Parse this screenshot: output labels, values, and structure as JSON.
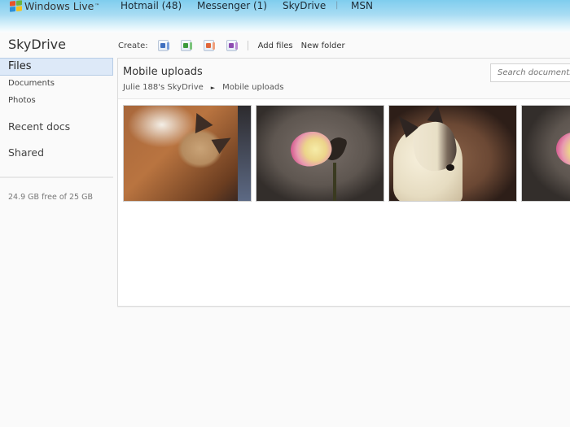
{
  "header": {
    "brand": "Windows Live",
    "brand_tm": "™",
    "nav": [
      {
        "label": "Hotmail (48)"
      },
      {
        "label": "Messenger (1)"
      },
      {
        "label": "SkyDrive"
      },
      {
        "label": "MSN"
      }
    ],
    "separator": "|"
  },
  "sidebar": {
    "title": "SkyDrive",
    "items": [
      {
        "label": "Files",
        "selected": true
      },
      {
        "label": "Documents"
      },
      {
        "label": "Photos"
      },
      {
        "label": "Recent docs"
      },
      {
        "label": "Shared"
      }
    ],
    "storage": "24.9 GB free of 25 GB"
  },
  "toolbar": {
    "create_label": "Create:",
    "create_icons": [
      {
        "name": "word-document-icon",
        "color": "#3f6fbf"
      },
      {
        "name": "excel-workbook-icon",
        "color": "#3c9a3c"
      },
      {
        "name": "powerpoint-presentation-icon",
        "color": "#e0663a"
      },
      {
        "name": "onenote-notebook-icon",
        "color": "#8d4bb0"
      }
    ],
    "add_files": "Add files",
    "new_folder": "New folder"
  },
  "folder": {
    "title": "Mobile uploads",
    "breadcrumb": [
      {
        "label": "Julie 188's SkyDrive"
      },
      {
        "label": "Mobile uploads"
      }
    ],
    "breadcrumb_arrow": "►",
    "search_placeholder": "Search documents",
    "photos": [
      {
        "subject": "dog lying on wood floor"
      },
      {
        "subject": "pink and yellow rose"
      },
      {
        "subject": "white dog looking up"
      },
      {
        "subject": "pink and yellow rose"
      }
    ]
  }
}
